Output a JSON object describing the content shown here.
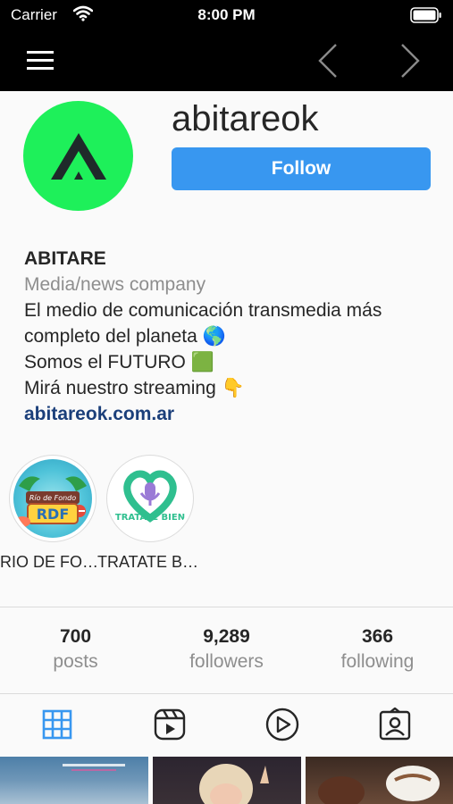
{
  "status_bar": {
    "carrier": "Carrier",
    "time": "8:00 PM"
  },
  "icons": {
    "menu": "hamburger-menu-icon",
    "back": "chevron-left-icon",
    "forward": "chevron-right-icon",
    "grid": "grid-icon",
    "reels": "reels-icon",
    "video": "play-circle-icon",
    "tagged": "tagged-person-icon"
  },
  "profile": {
    "username": "abitareok",
    "follow_label": "Follow",
    "avatar_color": "#1ef05a"
  },
  "bio": {
    "name": "ABITARE",
    "category": "Media/news company",
    "line1": "El medio de comunicación transmedia más",
    "line2": "completo del planeta 🌎",
    "line3": "Somos el FUTURO 🟩",
    "line4": "Mirá nuestro streaming 👇",
    "link": "abitareok.com.ar"
  },
  "highlights": [
    {
      "label": "RIO DE FONDO",
      "title": "RDF",
      "caption": "Río de Fondo"
    },
    {
      "label": "TRATATE BIEN",
      "title": "TRATATE BIEN"
    }
  ],
  "stats": [
    {
      "value": "700",
      "label": "posts"
    },
    {
      "value": "9,289",
      "label": "followers"
    },
    {
      "value": "366",
      "label": "following"
    }
  ],
  "colors": {
    "accent": "#3897f0",
    "link": "#1b3f7a",
    "muted": "#8e8e8e",
    "active_tab": "#3897f0"
  }
}
